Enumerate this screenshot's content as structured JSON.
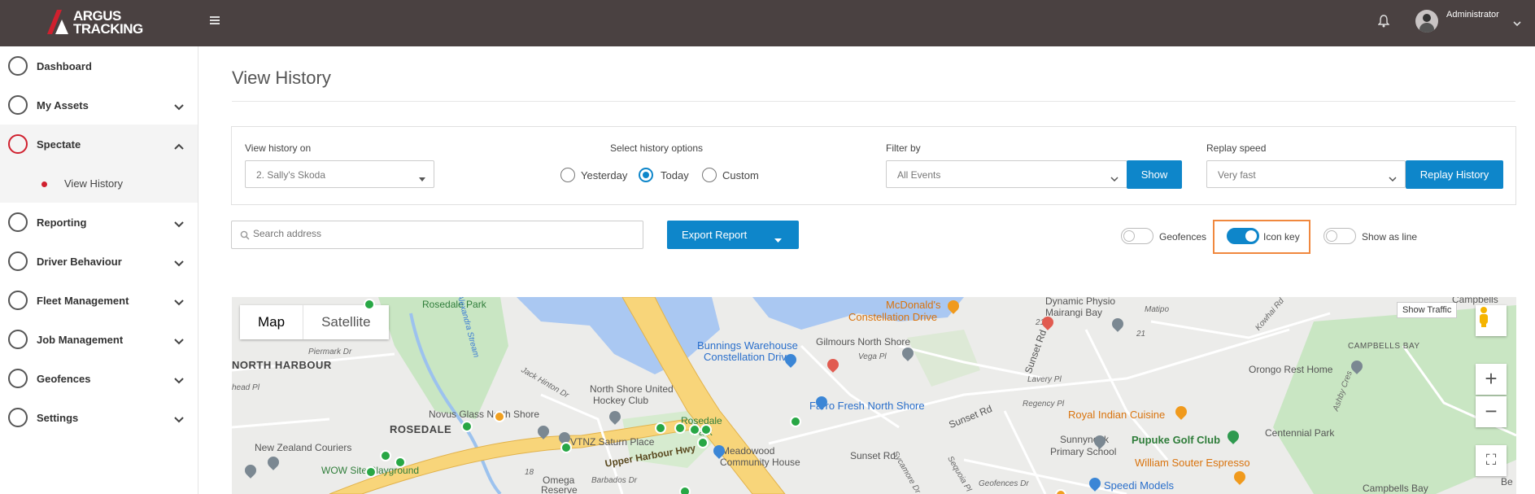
{
  "header": {
    "logo_line1": "ARGUS",
    "logo_line2": "TRACKING",
    "username": "Administrator"
  },
  "sidebar": {
    "items": [
      {
        "label": "Dashboard",
        "icon": "speedometer-icon"
      },
      {
        "label": "My Assets",
        "icon": "assets-icon"
      },
      {
        "label": "Spectate",
        "icon": "map-pin-icon"
      },
      {
        "label": "Reporting",
        "icon": "report-icon"
      },
      {
        "label": "Driver Behaviour",
        "icon": "lightbulb-icon"
      },
      {
        "label": "Fleet Management",
        "icon": "car-icon"
      },
      {
        "label": "Job Management",
        "icon": "briefcase-icon"
      },
      {
        "label": "Geofences",
        "icon": "geofence-icon"
      },
      {
        "label": "Settings",
        "icon": "gear-icon"
      }
    ],
    "sub_item": "View History"
  },
  "page": {
    "title": "View History"
  },
  "filters": {
    "history_on_label": "View history on",
    "history_on_value": "2. Sally's Skoda",
    "options_label": "Select history options",
    "options": [
      "Yesterday",
      "Today",
      "Custom"
    ],
    "selected_option": "Today",
    "filter_by_label": "Filter by",
    "filter_by_value": "All Events",
    "show_button": "Show",
    "replay_speed_label": "Replay speed",
    "replay_speed_value": "Very fast",
    "replay_button": "Replay History"
  },
  "tools": {
    "search_placeholder": "Search address",
    "export_button": "Export Report",
    "toggles": [
      {
        "label": "Geofences",
        "on": false
      },
      {
        "label": "Icon key",
        "on": true
      },
      {
        "label": "Show as line",
        "on": false
      }
    ]
  },
  "map": {
    "type_options": [
      "Map",
      "Satellite"
    ],
    "selected_type": "Map",
    "show_traffic": "Show Traffic",
    "labels": {
      "rosedale_park": "Rosedale Park",
      "mcdonalds": "McDonald's",
      "constellation_drive": "Constellation Drive",
      "dynamic_physio": "Dynamic Physio",
      "mairangi_bay": "Mairangi Bay",
      "campbells_bay": "CAMPBELLS BAY",
      "campbells": "Campbells",
      "bunnings": "Bunnings Warehouse",
      "bunnings_2": "Constellation Drive",
      "gilmours": "Gilmours North Shore",
      "orongo": "Orongo Rest Home",
      "north_harbour": "NORTH HARBOUR",
      "piermark": "Piermark Dr",
      "north_shore_united": "North Shore United",
      "hockey_club": "Hockey Club",
      "farro": "Farro Fresh North Shore",
      "sunset_rd": "Sunset Rd",
      "royal_indian": "Royal Indian Cuisine",
      "novus_glass": "Novus Glass North Shore",
      "rosedale": "ROSEDALE",
      "rosedale_park2": "Rosedale",
      "park": "Park",
      "pupuke": "Pupuke Golf Club",
      "centennial": "Centennial Park",
      "sunnynook": "Sunnynook",
      "primary_school": "Primary School",
      "new_zealand_couriers": "New Zealand Couriers",
      "vtnz": "VTNZ Saturn Place",
      "upper_harbour": "Upper Harbour Hwy",
      "meadowood": "Meadowood",
      "community_house": "Community House",
      "sunset_rd2": "Sunset Rd",
      "william_souter": "William Souter Espresso",
      "wow_site": "WOW Site Playground",
      "omega": "Omega",
      "reserve": "Reserve",
      "speedi": "Speedi Models",
      "campbells_bay2": "Campbells Bay",
      "alexandra_stream": "Alexandra Stream",
      "vega_pl": "Vega Pl",
      "jack_hinton": "Jack Hinton Dr",
      "regency_pl": "Regency Pl",
      "lavery_pl": "Lavery Pl",
      "sunset_rd3": "Sunset Rd",
      "matipo": "Matipo",
      "kowhai_rd": "Kowhai Rd",
      "ashby_cres": "Ashby Cres",
      "sycamore": "Sycamore Dr",
      "sequoia": "Sequoia Pl",
      "barbados": "Barbados Dr",
      "ahead_pl": "head Pl",
      "geofences_dr": "Geofences Dr",
      "road_21a": "21",
      "road_21b": "21",
      "road_18": "18",
      "be": "Be"
    }
  }
}
